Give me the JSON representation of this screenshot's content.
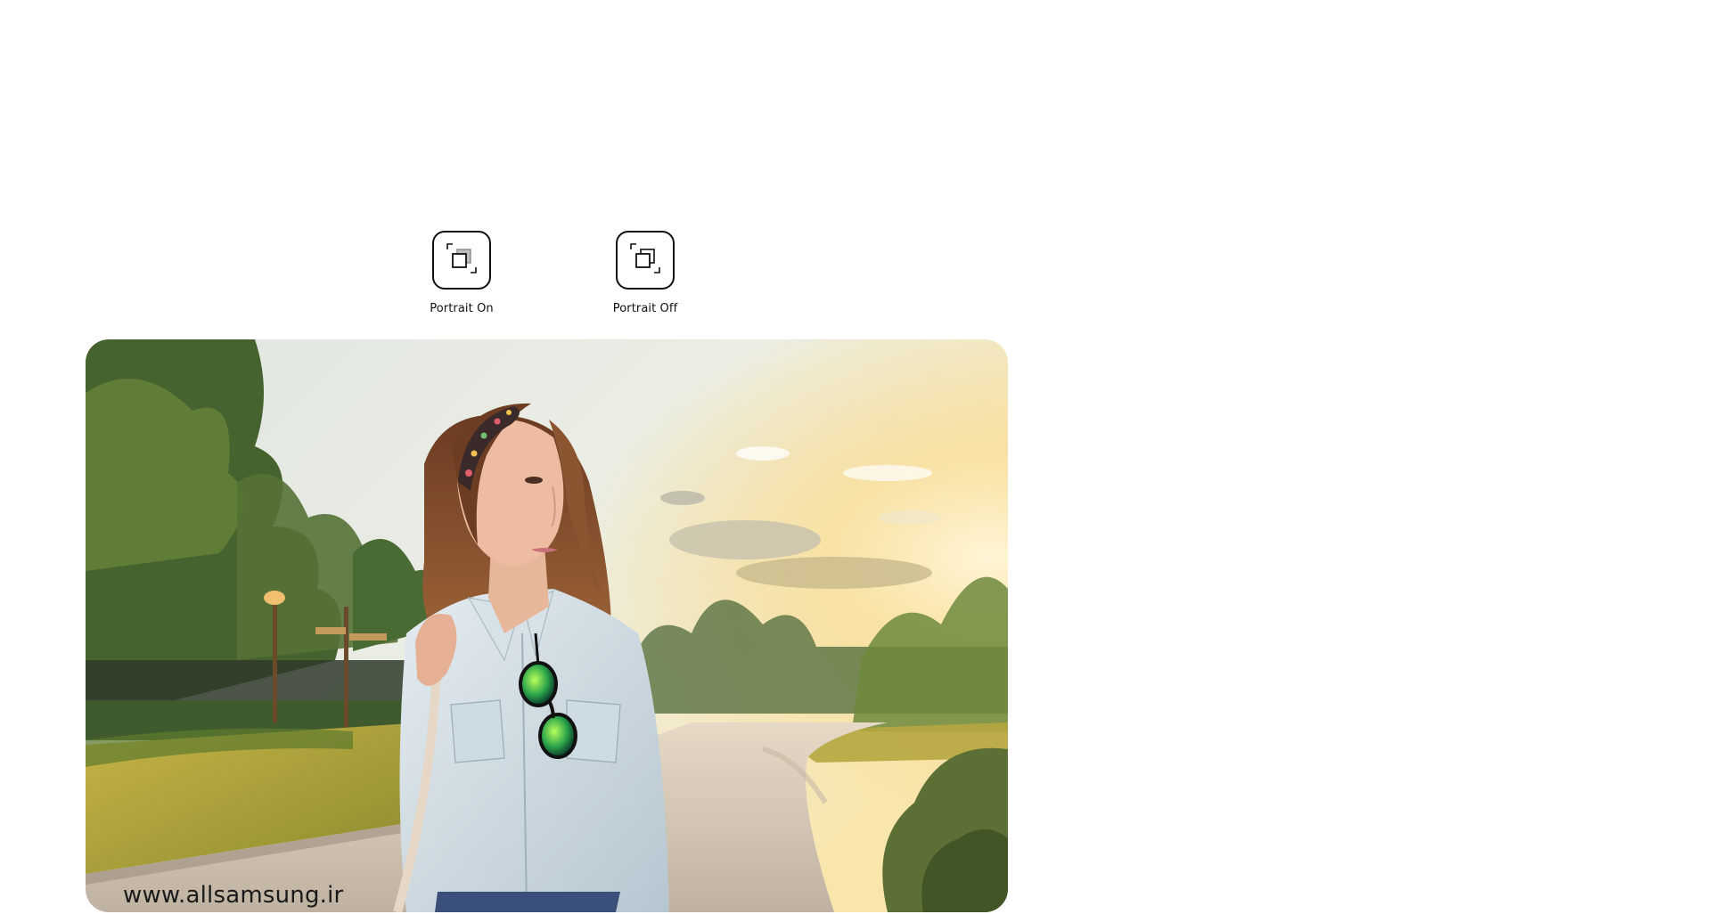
{
  "modes": {
    "portrait_on": {
      "label": "Portrait On",
      "icon": "portrait-on-icon"
    },
    "portrait_off": {
      "label": "Portrait Off",
      "icon": "portrait-off-icon"
    }
  },
  "photo": {
    "watermark": "www.allsamsung.ir"
  },
  "colors": {
    "icon_stroke": "#111111",
    "sky_top": "#e3e9e7",
    "sun_glow": "#f7e2a4",
    "grass": "#b6a43c",
    "path": "#d8c7b2"
  }
}
